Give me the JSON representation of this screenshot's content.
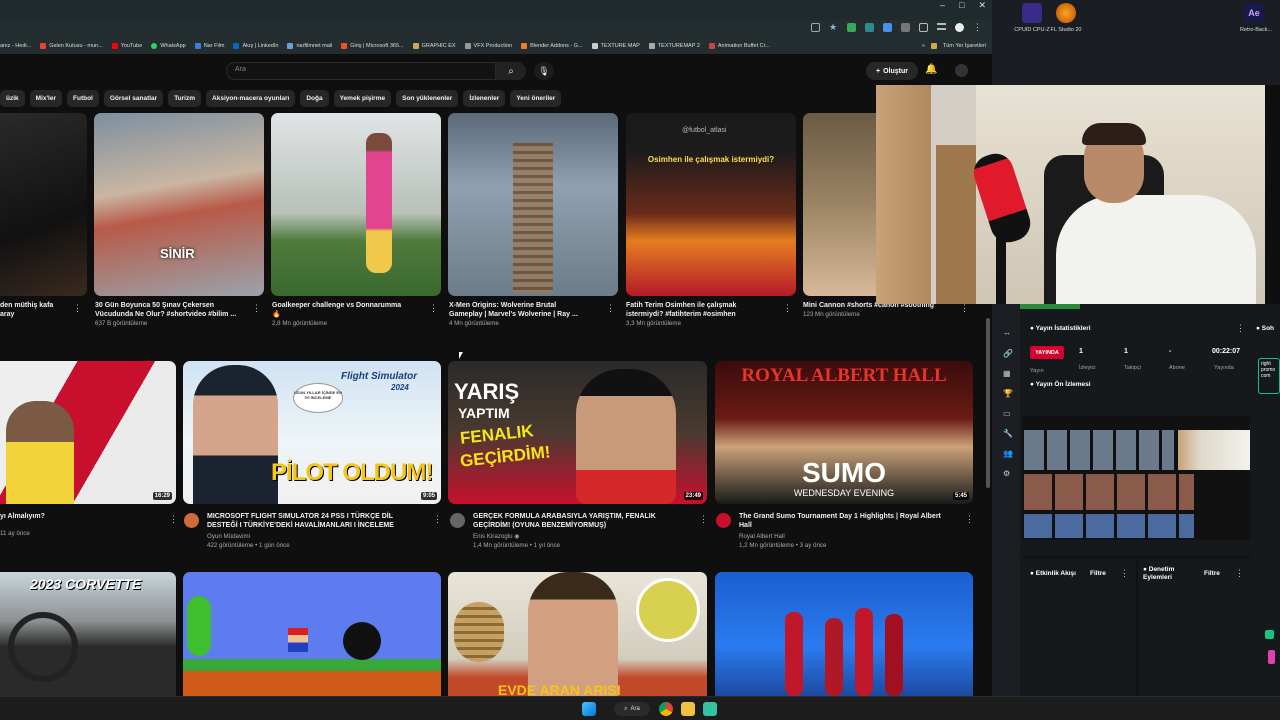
{
  "window_controls": [
    "–",
    "□",
    "✕"
  ],
  "bookmarks": [
    {
      "label": "anız - Hedi..."
    },
    {
      "label": "Gelen Kutusu - mun..."
    },
    {
      "label": "YouTube"
    },
    {
      "label": "WhatsApp"
    },
    {
      "label": "Nar Film"
    },
    {
      "label": "Akış | LinkedIn"
    },
    {
      "label": "narfilmnet mail"
    },
    {
      "label": "Giriş | Microsoft 365..."
    },
    {
      "label": "GRAPHIC EX"
    },
    {
      "label": "VFX Production"
    },
    {
      "label": "Blender Addons - G..."
    },
    {
      "label": "TEXTURE MAP"
    },
    {
      "label": "TEXTUREMAP 2"
    },
    {
      "label": "Animation Buffet Cr..."
    }
  ],
  "bookmarks_more": "»",
  "bookmarks_all": "Tüm Yer İşaretleri",
  "search": {
    "placeholder": "Ara"
  },
  "header": {
    "create_label": "Oluştur"
  },
  "chips": [
    "üzik",
    "Mix'ler",
    "Futbol",
    "Görsel sanatlar",
    "Turizm",
    "Aksiyon-macera oyunları",
    "Doğa",
    "Yemek pişirme",
    "Son yüklenenler",
    "İzlenenler",
    "Yeni öneriler"
  ],
  "row1": [
    {
      "title1": "den müthiş kafa",
      "title2": "aray",
      "views": ""
    },
    {
      "title1": "30 Gün Boyunca 50 Şınav Çekersen",
      "title2": "Vücudunda Ne Olur? #shortvideo #bilim ...",
      "views": "637 B görüntüleme",
      "overlay": "SİNİR"
    },
    {
      "title1": "Goalkeeper challenge vs Donnarumma",
      "title2": "🔥",
      "views": "2,8 Mn görüntüleme"
    },
    {
      "title1": "X-Men Origins: Wolverine Brutal",
      "title2": "Gameplay | Marvel's Wolverine | Ray ...",
      "views": "4 Mn görüntüleme"
    },
    {
      "title1": "Fatih Terim Osimhen ile çalışmak",
      "title2": "istermiydi? #fatihterim #osimhen",
      "views": "3,3 Mn görüntüleme",
      "overlay": "Osimhen ile çalışmak istermiydi?",
      "watermark": "@futbol_atlasi"
    },
    {
      "title1": "Mini Cannon #shorts #canon #soothing",
      "title2": "",
      "views": "123 Mn görüntüleme"
    }
  ],
  "row2": [
    {
      "title1": "yı Almalıyım?",
      "channel": "",
      "stats": "11 ay önce",
      "duration": "16:29"
    },
    {
      "title1": "MICROSOFT FLIGHT SIMULATOR 24 PSS I TÜRKÇE DİL",
      "title2": "DESTEĞİ I TÜRKİYE'DEKİ HAVALİMANLARI I İNCELEME",
      "channel": "Oyun Müdavimi",
      "stats": "422 görüntüleme • 1 gün önce",
      "duration": "9:05",
      "overlay": "PİLOT OLDUM!",
      "logo_text": "Flight Simulator",
      "logo_year": "2024",
      "bubble": "UZUN YILLAR İÇİNDE EN İYİ İNCELEME"
    },
    {
      "title1": "GERÇEK FORMULA ARABASIYLA YARIŞTIM, FENALIK",
      "title2": "GEÇİRDİM! (OYUNA BENZEMİYORMUŞ)",
      "channel": "Enis Kirazoglu",
      "stats": "1,4 Mn görüntüleme • 1 yıl önce",
      "duration": "23:49",
      "overlay1": "YARIŞ",
      "overlay2": "YAPTIM",
      "overlay3": "FENALIK",
      "overlay4": "GEÇİRDİM!"
    },
    {
      "title1": "The Grand Sumo Tournament Day 1 Highlights | Royal Albert",
      "title2": "Hall",
      "channel": "Royal Albert Hall",
      "stats": "1,2 Mn görüntüleme • 3 ay önce",
      "duration": "5:45",
      "overlay1": "ROYAL ALBERT HALL",
      "overlay2": "SUMO",
      "overlay3": "WEDNESDAY EVENING"
    }
  ],
  "row3": [
    {
      "overlay": "2023 CORVETTE"
    },
    {},
    {
      "overlay": "EVDE ARAN ARISI"
    },
    {}
  ],
  "desktop_icons": [
    {
      "label": "CPUID CPU-Z"
    },
    {
      "label": "FL Studio 20"
    },
    {
      "label": "Retro-Back..."
    }
  ],
  "obs": {
    "stats_title": "Yayın İstatistikleri",
    "live_badge": "YAYINDA",
    "stats": [
      {
        "value": "1",
        "label": "İzleyici"
      },
      {
        "value": "1",
        "label": "Takipçi"
      },
      {
        "value": "-",
        "label": "Abone"
      },
      {
        "value": "00:22:07",
        "label": "Yayında"
      }
    ],
    "stat_extra": "Yayın",
    "preview_title": "Yayın Ön İzlemesi",
    "activity_title": "Etkinlik Akışı",
    "activity_filter": "Filtre",
    "audit_title": "Denetim Eylemleri",
    "audit_filter": "Filtre",
    "right_tab": "Soh",
    "right_note": "right promo com"
  },
  "taskbar": {
    "search_label": "Ara"
  },
  "colors": {
    "yt_bg": "#0f0f0f",
    "chip_bg": "#272727",
    "live_red": "#d6002f",
    "accent_green": "#19c37d"
  }
}
